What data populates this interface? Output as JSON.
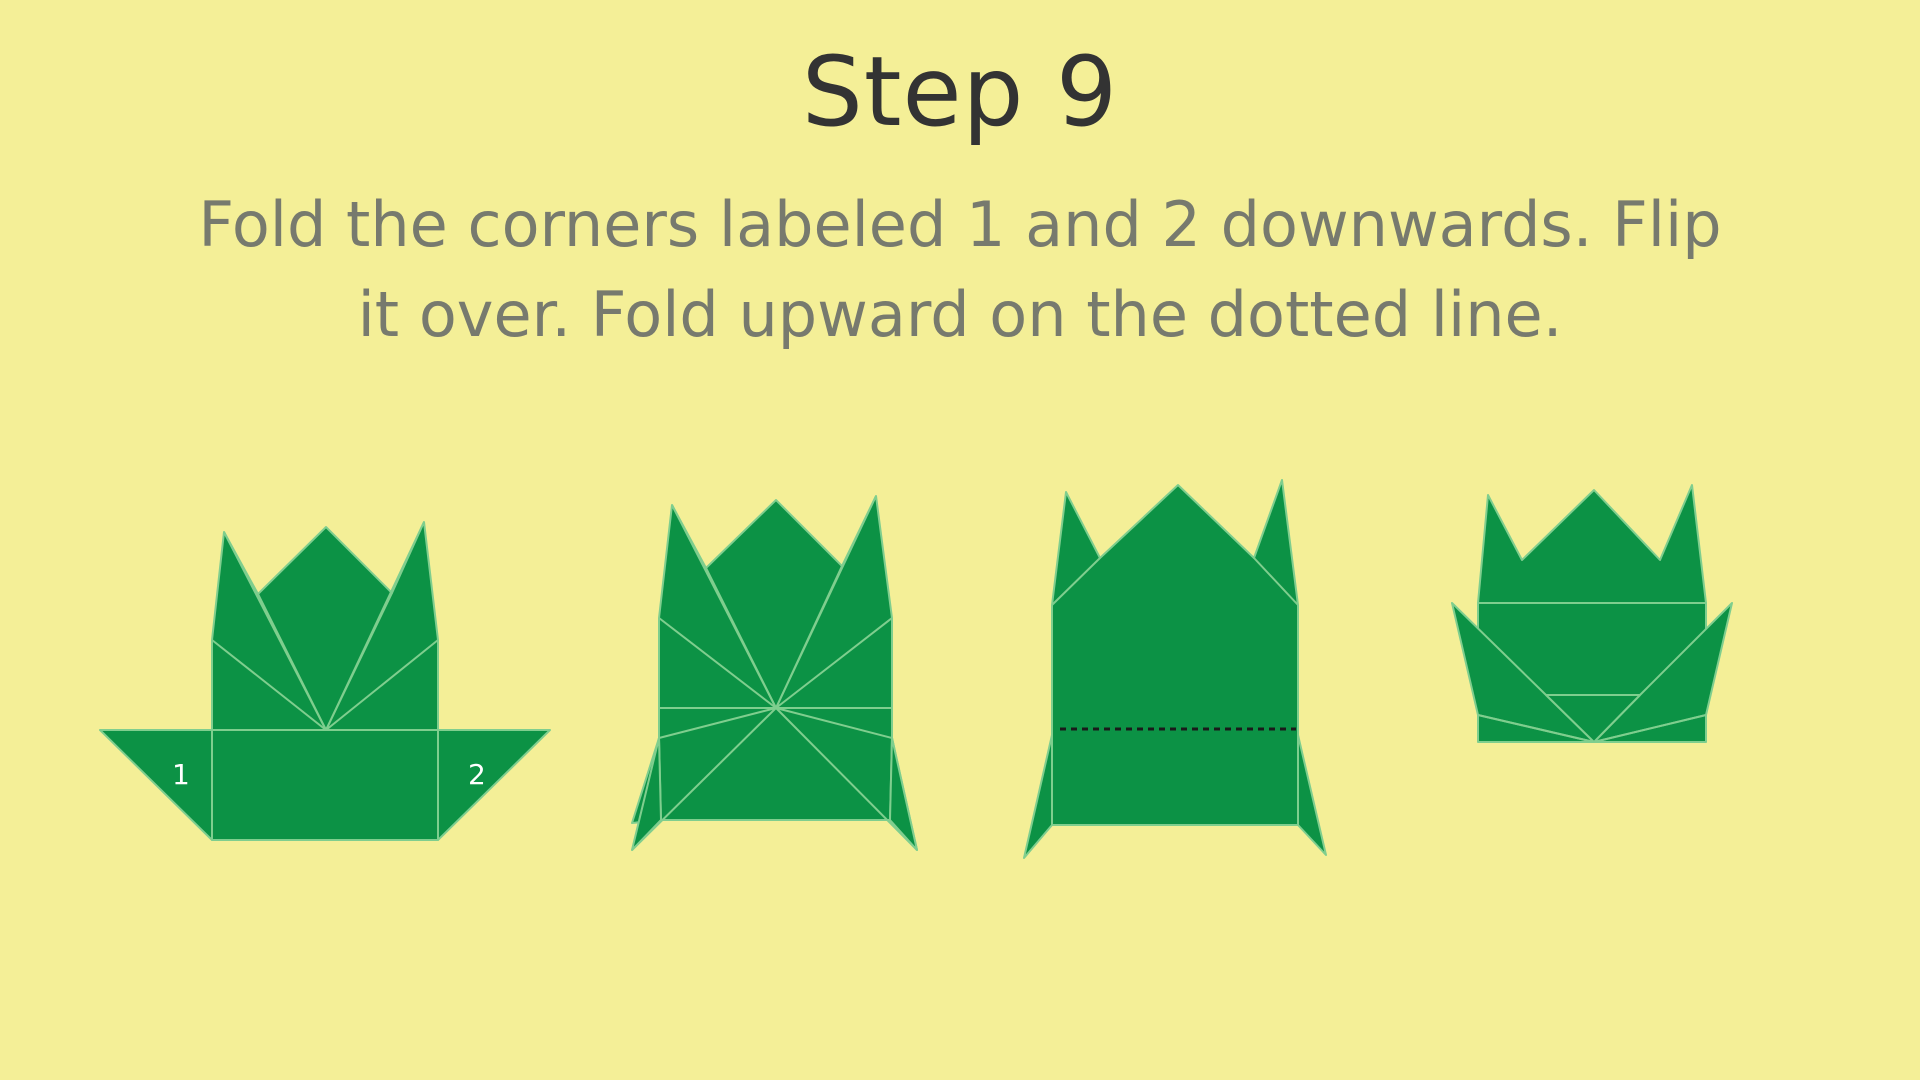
{
  "step": {
    "title": "Step 9",
    "instructions_line1": "Fold the corners labeled 1 and 2 downwards. Flip",
    "instructions_line2": "it over. Fold upward on the dotted line."
  },
  "diagram": {
    "stages": [
      "stage-1",
      "stage-2",
      "stage-3",
      "stage-4"
    ],
    "corner_labels": [
      "1",
      "2"
    ],
    "colors": {
      "background": "#f4ef97",
      "paper": "#0c9245",
      "crease": "#7fce8e",
      "title": "#333333",
      "instructions": "#777a6e"
    }
  }
}
